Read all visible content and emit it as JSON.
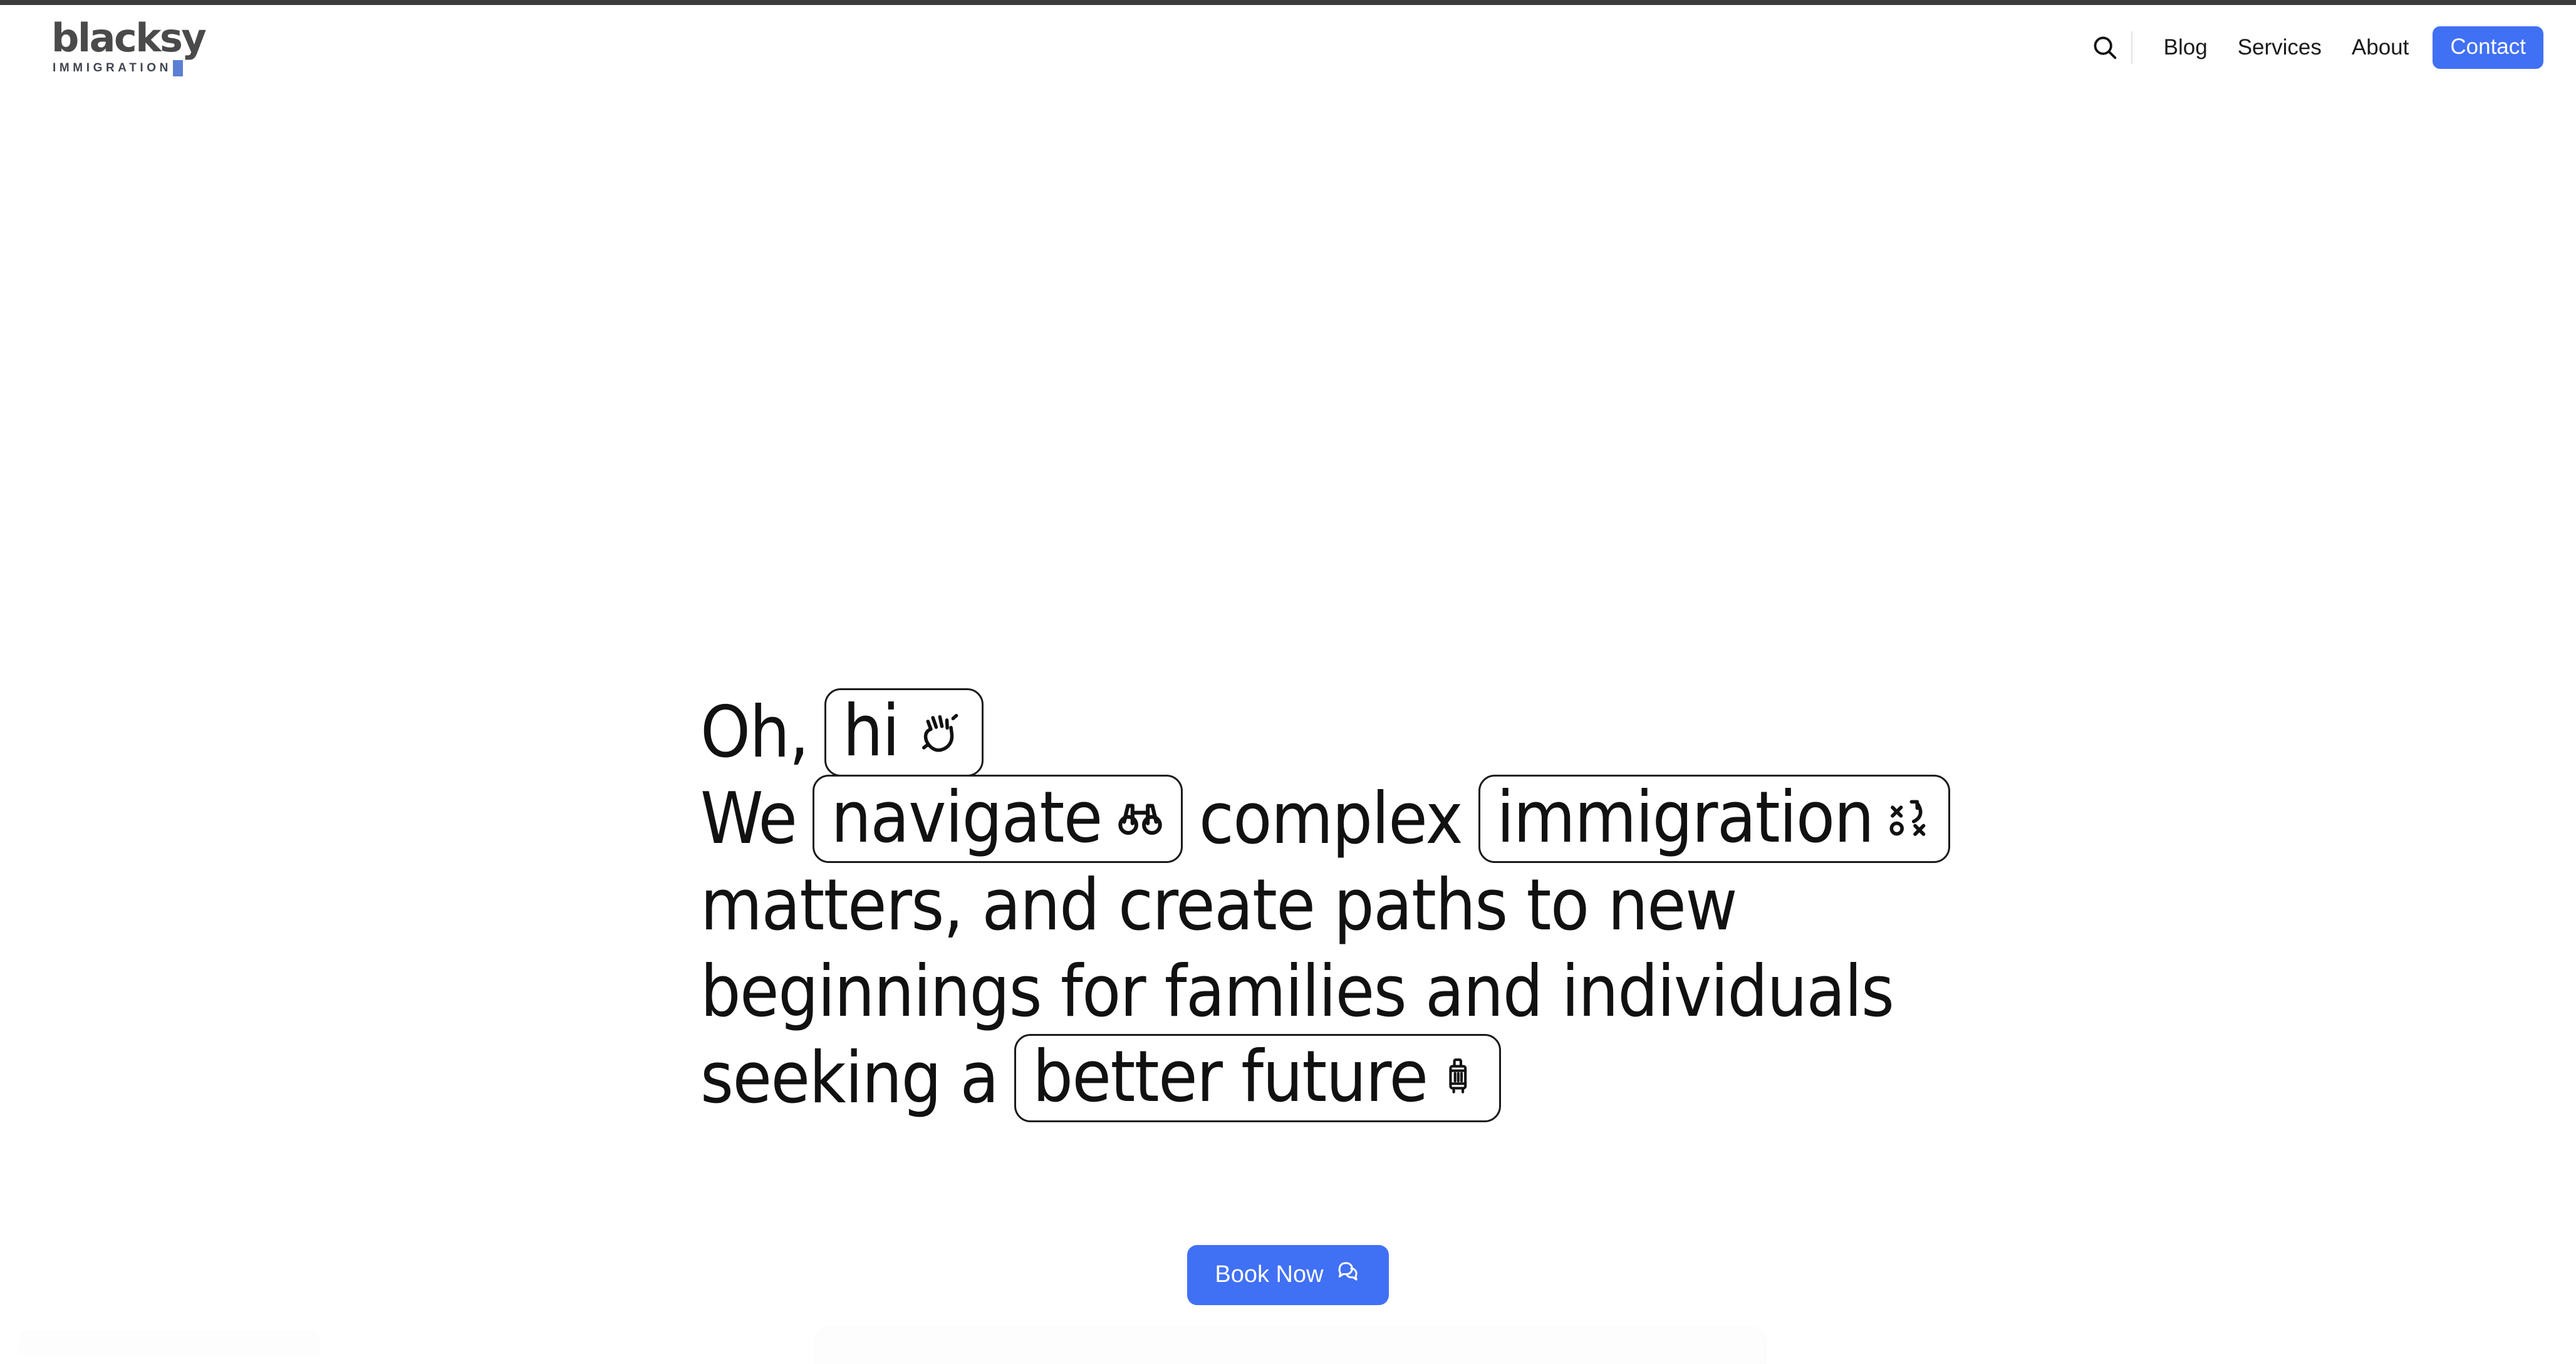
{
  "brand": {
    "wordmark": "blacksy",
    "tagline": "IMMIGRATION",
    "tagline_accent_letter": "S",
    "accent_color": "#5a7fd4",
    "wordmark_color": "#4a4a4a"
  },
  "theme": {
    "primary_blue": "#4070f4",
    "text_black": "#111111",
    "page_background": "#ffffff",
    "chrome_bar": "#3c3c3c"
  },
  "header": {
    "search_icon": "search-icon",
    "links": [
      {
        "label": "Blog"
      },
      {
        "label": "Services"
      },
      {
        "label": "About"
      }
    ],
    "cta": {
      "label": "Contact"
    }
  },
  "hero": {
    "lines": [
      {
        "segments": [
          {
            "type": "text",
            "value": "Oh,"
          },
          {
            "type": "chip",
            "value": "hi",
            "icon": "waving-hand-icon"
          }
        ]
      },
      {
        "segments": [
          {
            "type": "text",
            "value": "We"
          },
          {
            "type": "chip",
            "value": "navigate",
            "icon": "binoculars-icon"
          },
          {
            "type": "text",
            "value": "complex"
          },
          {
            "type": "chip",
            "value": "immigration",
            "icon": "strategy-icon"
          }
        ]
      },
      {
        "segments": [
          {
            "type": "text",
            "value": "matters, and create paths to new"
          }
        ]
      },
      {
        "segments": [
          {
            "type": "text",
            "value": "beginnings for families and individuals"
          }
        ]
      },
      {
        "segments": [
          {
            "type": "text",
            "value": "seeking a"
          },
          {
            "type": "chip",
            "value": "better future",
            "icon": "suitcase-icon"
          }
        ]
      }
    ],
    "full_text": "Oh, hi 👋 We navigate complex immigration matters, and create paths to new beginnings for families and individuals seeking a better future 🧳"
  },
  "cta": {
    "label": "Book Now",
    "icon": "chat-bubbles-icon"
  }
}
